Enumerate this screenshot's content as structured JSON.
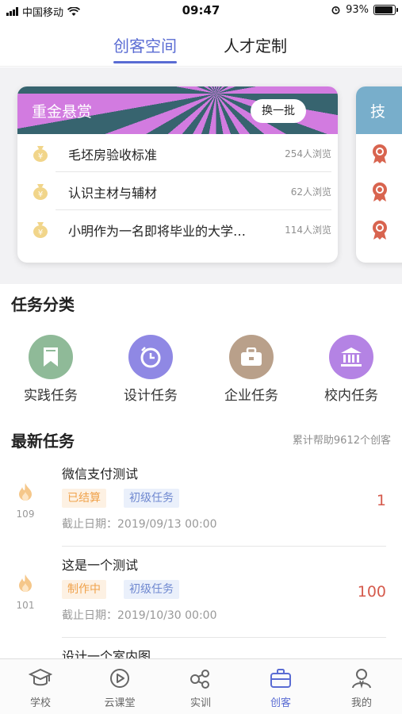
{
  "status_bar": {
    "carrier": "中国移动",
    "time": "09:47",
    "battery": "93%"
  },
  "top_tabs": [
    {
      "label": "创客空间",
      "active": true
    },
    {
      "label": "人才定制",
      "active": false
    }
  ],
  "bounty_card": {
    "title": "重金悬赏",
    "refresh_label": "换一批",
    "items": [
      {
        "title": "毛坯房验收标准",
        "views": "254人浏览"
      },
      {
        "title": "认识主材与辅材",
        "views": "62人浏览"
      },
      {
        "title": "小明作为一名即将毕业的大学…",
        "views": "114人浏览"
      }
    ]
  },
  "second_card": {
    "title_partial": "技"
  },
  "categories": {
    "title": "任务分类",
    "items": [
      {
        "label": "实践任务",
        "color": "#8fba98",
        "icon": "bookmark-icon"
      },
      {
        "label": "设计任务",
        "color": "#8f88e4",
        "icon": "clock-icon"
      },
      {
        "label": "企业任务",
        "color": "#b9a08a",
        "icon": "briefcase-icon"
      },
      {
        "label": "校内任务",
        "color": "#b483e4",
        "icon": "bank-icon"
      }
    ]
  },
  "latest": {
    "title": "最新任务",
    "helped": "累计帮助9612个创客",
    "tasks": [
      {
        "title": "微信支付测试",
        "status": "已结算",
        "level": "初级任务",
        "deadline": "截止日期：2019/09/13 00:00",
        "amount": "1",
        "hot": "109"
      },
      {
        "title": "这是一个测试",
        "status": "制作中",
        "level": "初级任务",
        "deadline": "截止日期：2019/10/30 00:00",
        "amount": "100",
        "hot": "101"
      },
      {
        "title": "设计一个室内图"
      }
    ]
  },
  "bottom_nav": [
    {
      "label": "学校",
      "icon": "school-icon",
      "active": false
    },
    {
      "label": "云课堂",
      "icon": "play-icon",
      "active": false
    },
    {
      "label": "实训",
      "icon": "training-icon",
      "active": false
    },
    {
      "label": "创客",
      "icon": "bag-icon",
      "active": true
    },
    {
      "label": "我的",
      "icon": "user-icon",
      "active": false
    }
  ],
  "colors": {
    "accent": "#5a6cd3",
    "amount": "#d55a4c",
    "status_tag": "#f0a24b",
    "level_tag": "#6f88d0"
  }
}
